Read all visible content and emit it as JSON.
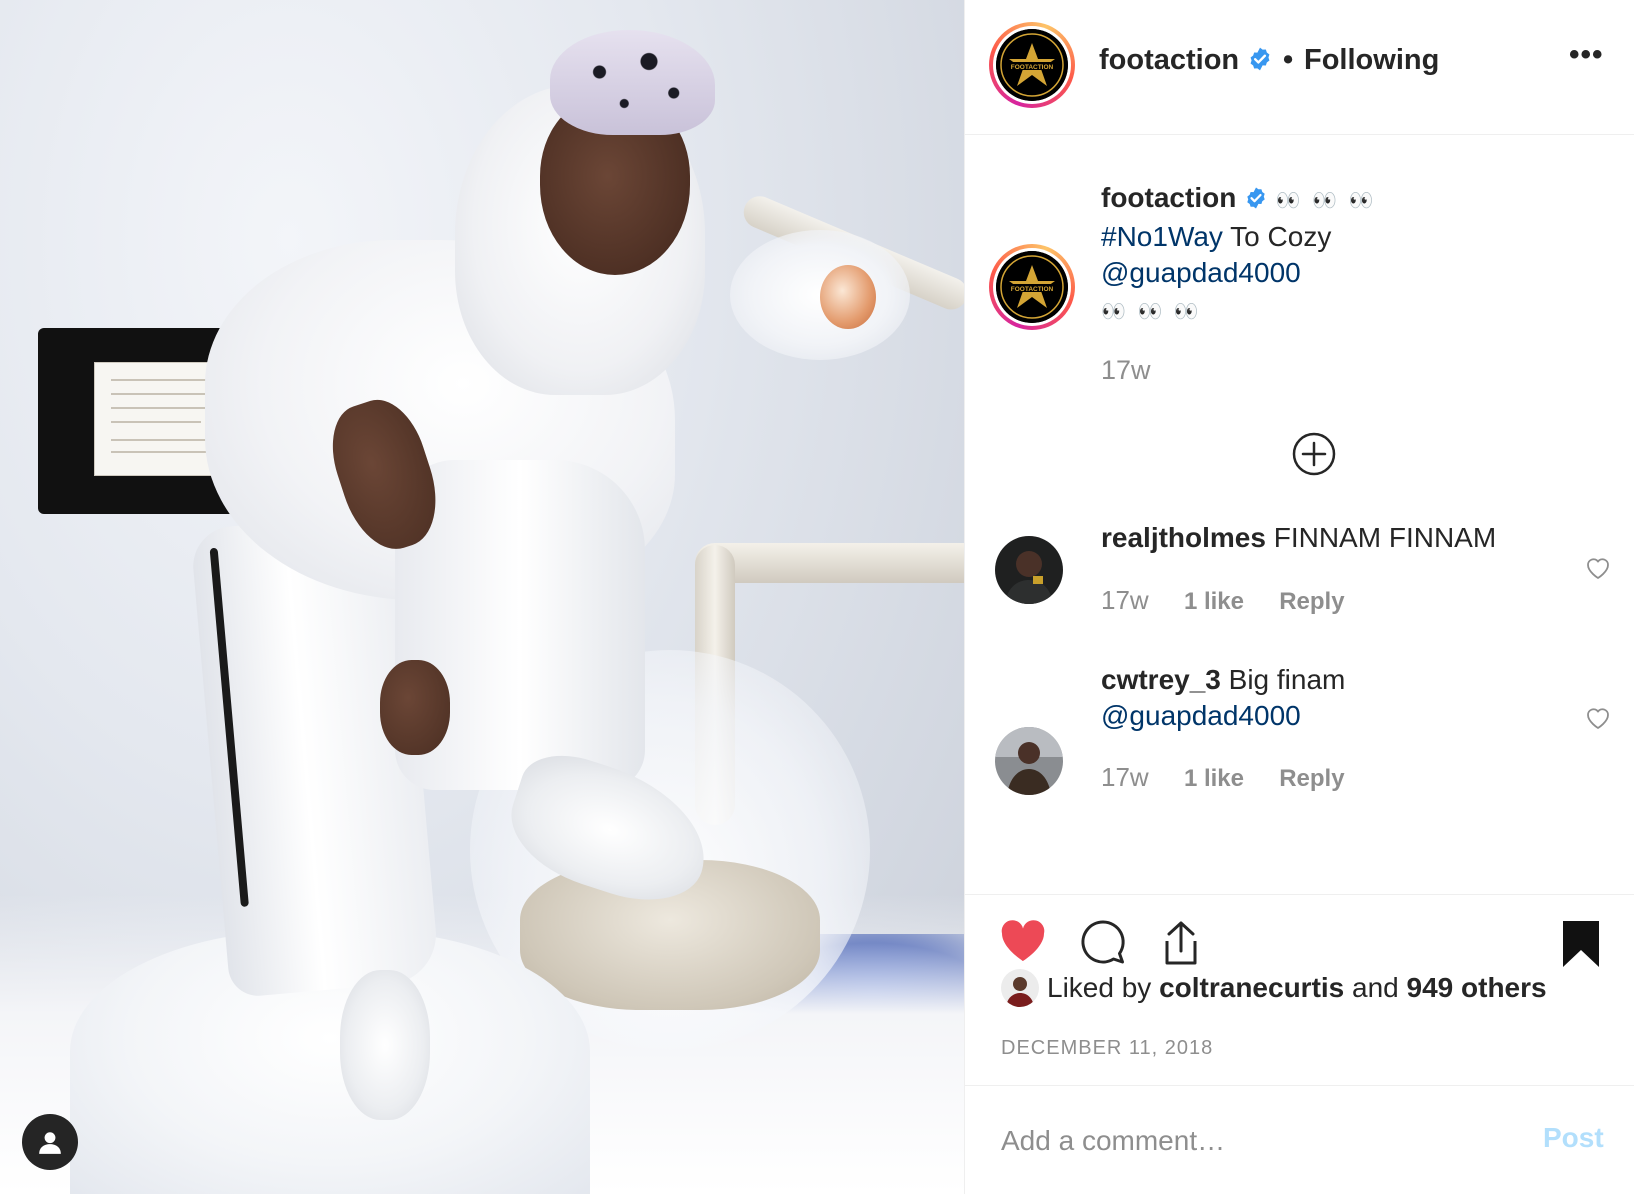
{
  "photo": {
    "alt_icon": "user-silhouette-icon"
  },
  "header": {
    "username": "footaction",
    "verified_icon": "verified-badge-icon",
    "dot": "•",
    "follow_status": "Following",
    "more_icon": "more-options-icon",
    "more_label": "•••",
    "logo_text": "FOOTACTION"
  },
  "caption": {
    "username": "footaction",
    "eyes_line1": "👀 👀 👀",
    "hashtag": "#No1Way",
    "text_after_hashtag": " To Cozy",
    "mention": "@guapdad4000",
    "eyes_line2": "👀 👀 👀",
    "time": "17w"
  },
  "load_more_icon": "plus-circle-icon",
  "comments": [
    {
      "username": "realjtholmes",
      "text": "FINNAM FINNAM",
      "mention": "",
      "time": "17w",
      "likes": "1 like",
      "reply": "Reply"
    },
    {
      "username": "cwtrey_3",
      "text": "Big finam",
      "mention": "@guapdad4000",
      "time": "17w",
      "likes": "1 like",
      "reply": "Reply"
    }
  ],
  "actions": {
    "like_icon": "heart-filled-icon",
    "comment_icon": "comment-bubble-icon",
    "share_icon": "share-upload-icon",
    "save_icon": "bookmark-filled-icon",
    "liked_by_prefix": "Liked by",
    "liked_by_user": "coltranecurtis",
    "liked_by_and": "and",
    "liked_by_others": "949 others",
    "date": "DECEMBER 11, 2018"
  },
  "comment_box": {
    "placeholder": "Add a comment…",
    "post_label": "Post"
  },
  "colors": {
    "like_red": "#ed4956",
    "link_blue": "#003569",
    "post_disabled": "#b2dffc",
    "verified_blue": "#3897f0",
    "muted": "#8e8e8e"
  }
}
